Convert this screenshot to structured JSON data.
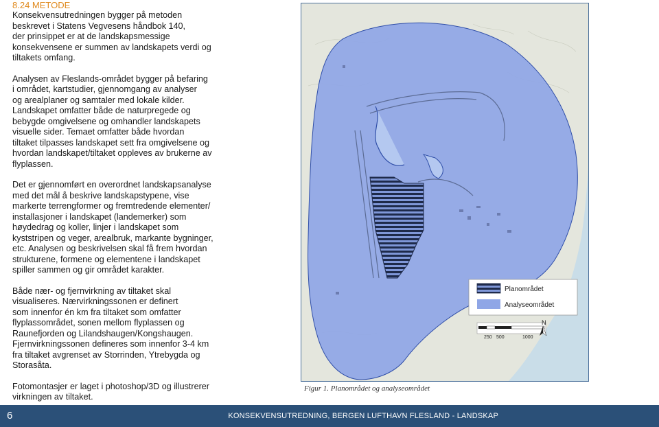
{
  "section": {
    "heading": "8.24 METODE",
    "paragraphs": [
      "Konsekvensutredningen bygger på metoden\nbeskrevet i Statens Vegvesens håndbok 140,\nder prinsippet er at de landskapsmessige\nkonsekvensene er summen av landskapets verdi og\ntiltakets omfang.",
      "Analysen av Fleslands-området bygger på befaring\ni området, kartstudier, gjennomgang av analyser\nog arealplaner og samtaler med lokale kilder.\nLandskapet omfatter både de naturpregede og\nbebygde omgivelsene og omhandler landskapets\nvisuelle sider. Temaet omfatter både hvordan\ntiltaket tilpasses landskapet sett fra omgivelsene og\nhvordan landskapet/tiltaket oppleves av brukerne av\nflyplassen.",
      "Det er gjennomført en overordnet landskapsanalyse\nmed det mål å beskrive landskapstypene, vise\nmarkerte terrengformer og fremtredende elementer/\ninstallasjoner i landskapet (landemerker) som\nhøydedrag og koller, linjer i landskapet som\nkyststripen og veger, arealbruk, markante bygninger,\netc. Analysen og beskrivelsen skal få frem hvordan\nstrukturene, formene og elementene i landskapet\nspiller sammen og gir området karakter.",
      "Både nær- og fjernvirkning av tiltaket skal\nvisualiseres. Nærvirkningssonen er definert\nsom innenfor én km fra tiltaket som omfatter\nflyplassområdet, sonen mellom flyplassen og\nRaunefjorden og Lilandshaugen/Kongshaugen.\nFjernvirkningssonen defineres som innenfor 3-4 km\nfra tiltaket avgrenset av Storrinden, Ytrebygda og\nStorasåta.",
      "Fotomontasjer er laget i photoshop/3D og illustrerer\nvirkningen av tiltaket."
    ]
  },
  "map": {
    "legend": {
      "plan_label": "Planområdet",
      "analysis_label": "Analyseområdet"
    },
    "scale": {
      "labels": [
        "250",
        "500",
        "1000"
      ],
      "north": "N"
    },
    "colors": {
      "analysis_fill": "#8fa6e6",
      "analysis_stroke": "#2f4ea8",
      "plan_stripe": "#1e2a4a",
      "land": "#e4e6dd",
      "water": "#c9dde8"
    }
  },
  "caption": "Figur 1. Planområdet og analyseområdet",
  "footer": {
    "page_number": "6",
    "title": "KONSEKVENSUTREDNING, BERGEN LUFTHAVN FLESLAND - LANDSKAP"
  }
}
